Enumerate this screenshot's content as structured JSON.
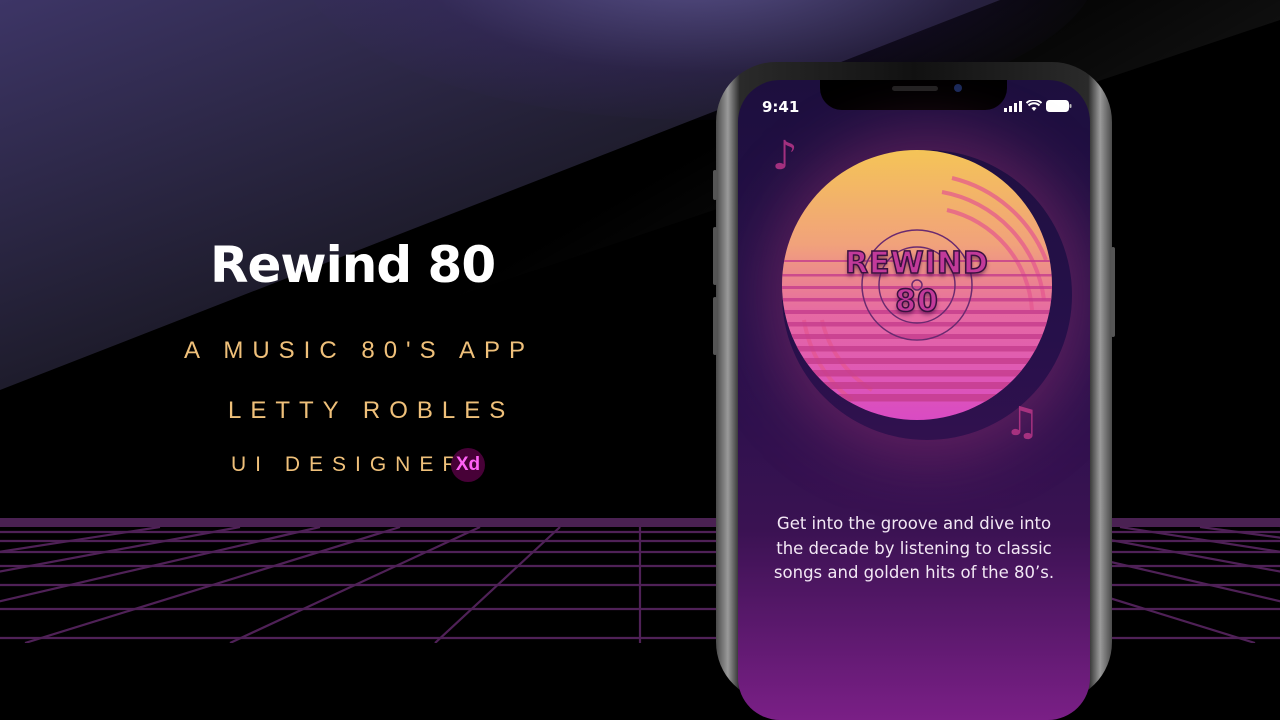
{
  "hero": {
    "title": "Rewind 80",
    "subtitle": "A MUSIC 80'S APP",
    "author": "LETTY ROBLES",
    "role": "UI DESIGNER",
    "tool_badge": "Xd"
  },
  "phone": {
    "status_time": "9:41",
    "status_icons": [
      "signal-icon",
      "wifi-icon",
      "battery-icon"
    ],
    "logo_line1": "REWIND",
    "logo_line2": "80",
    "description": "Get into the groove and dive into the decade by listening to classic songs and golden hits of the 80’s."
  },
  "colors": {
    "accent_gold": "#efc07a",
    "grid_purple": "#4a2152",
    "xd_bg": "#470137",
    "xd_text": "#ff61f6"
  }
}
